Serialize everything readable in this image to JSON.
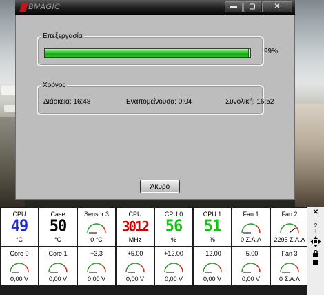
{
  "window": {
    "app_logo_text": "BMAGIC",
    "controls": {
      "minimize": "▬",
      "maximize": "▢",
      "close": "✕"
    }
  },
  "processing": {
    "group_label": "Επεξεργασία",
    "progress_percent": 99,
    "progress_text": "99%"
  },
  "time": {
    "group_label": "Χρόνος",
    "duration": "Διάρκεια: 16:48",
    "remaining": "Εναπομείνουσα: 0:04",
    "total": "Συνολική: 16:52"
  },
  "buttons": {
    "cancel": "Άκυρο"
  },
  "colors": {
    "progress_green": "#12a812",
    "digits_blue": "#1f2cd6",
    "digits_black": "#000000",
    "digits_red": "#d40000",
    "digits_green": "#13c413",
    "gauge_green": "#2c9b2c",
    "gauge_red": "#cf2b12"
  },
  "sensors": {
    "row1": [
      {
        "title": "CPU",
        "display": "digits",
        "digits": "49",
        "color": "digits_blue",
        "value": "°C"
      },
      {
        "title": "Case",
        "display": "digits",
        "digits": "50",
        "color": "digits_black",
        "value": "°C"
      },
      {
        "title": "Sensor 3",
        "display": "gauge",
        "level": 0,
        "value": "0 °C"
      },
      {
        "title": "CPU",
        "display": "digits",
        "digits": "3012",
        "color": "digits_red",
        "value": "MHz"
      },
      {
        "title": "CPU 0",
        "display": "digits",
        "digits": "56",
        "color": "digits_green",
        "value": "%"
      },
      {
        "title": "CPU 1",
        "display": "digits",
        "digits": "51",
        "color": "digits_green",
        "value": "%"
      },
      {
        "title": "Fan 1",
        "display": "gauge",
        "level": 0,
        "value": "0 Σ.Α.Λ"
      },
      {
        "title": "Fan 2",
        "display": "gauge",
        "level": 0.78,
        "value": "2295 Σ.Α.Λ"
      }
    ],
    "row2": [
      {
        "title": "Core 0",
        "display": "gauge",
        "level": 0,
        "value": "0,00 V"
      },
      {
        "title": "Core 1",
        "display": "gauge",
        "level": 0,
        "value": "0,00 V"
      },
      {
        "title": "+3.3",
        "display": "gauge",
        "level": 0,
        "value": "0,00 V"
      },
      {
        "title": "+5.00",
        "display": "gauge",
        "level": 0,
        "value": "0,00 V"
      },
      {
        "title": "+12.00",
        "display": "gauge",
        "level": 0,
        "value": "0,00 V"
      },
      {
        "title": "-12.00",
        "display": "gauge",
        "level": 0,
        "value": "0,00 V"
      },
      {
        "title": "-5.00",
        "display": "gauge",
        "level": 0,
        "value": "0,00 V"
      },
      {
        "title": "Fan 3",
        "display": "gauge",
        "level": 0,
        "value": "0 Σ.Α.Λ"
      }
    ]
  },
  "gadget_controls": {
    "close": "✕",
    "size_down": "−",
    "size_level": "2",
    "size_up": "+"
  }
}
